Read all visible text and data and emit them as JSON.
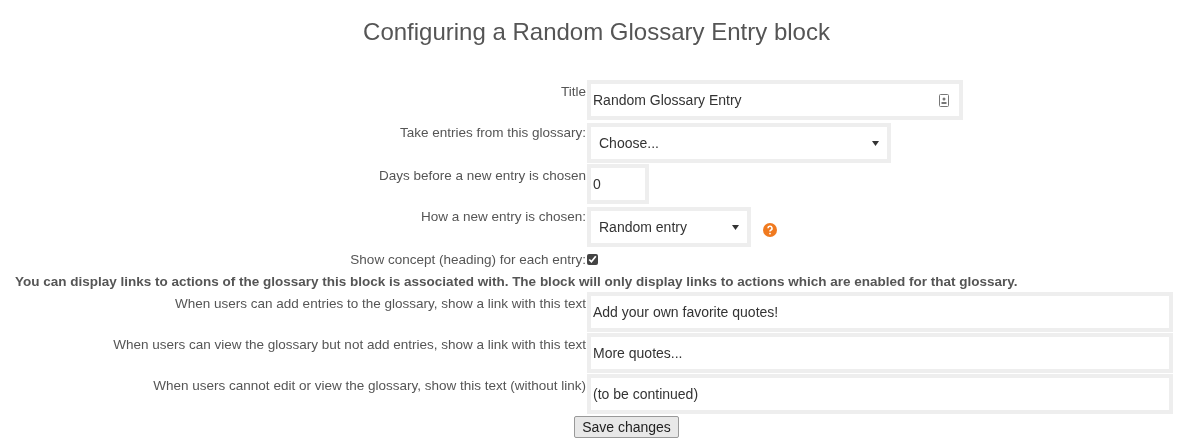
{
  "heading": "Configuring a Random Glossary Entry block",
  "fields": [
    {
      "kind": "text",
      "label": "Title",
      "value": "Random Glossary Entry",
      "icon": true
    },
    {
      "kind": "select",
      "label": "Take entries from this glossary:",
      "value": "Choose..."
    },
    {
      "kind": "text",
      "label": "Days before a new entry is chosen",
      "value": "0"
    },
    {
      "kind": "select",
      "label": "How a new entry is chosen:",
      "value": "Random entry",
      "help": true
    },
    {
      "kind": "checkbox",
      "label": "Show concept (heading) for each entry:",
      "checked": true
    },
    {
      "kind": "notice",
      "label": "You can display links to actions of the glossary this block is associated with. The block will only display links to actions which are enabled for that glossary."
    },
    {
      "kind": "text",
      "label": "When users can add entries to the glossary, show a link with this text",
      "value": "Add your own favorite quotes!"
    },
    {
      "kind": "text",
      "label": "When users can view the glossary but not add entries, show a link with this text",
      "value": "More quotes..."
    },
    {
      "kind": "text",
      "label": "When users cannot edit or view the glossary, show this text (without link)",
      "value": "(to be continued)"
    }
  ],
  "button": "Save changes"
}
